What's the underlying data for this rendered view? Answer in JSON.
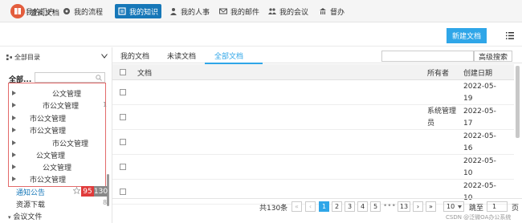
{
  "nav": {
    "items": [
      {
        "label": "我的门户",
        "icon": "portal-icon"
      },
      {
        "label": "我的流程",
        "icon": "workflow-icon"
      },
      {
        "label": "我的知识",
        "icon": "knowledge-icon"
      },
      {
        "label": "我的人事",
        "icon": "person-icon"
      },
      {
        "label": "我的邮件",
        "icon": "mail-icon"
      },
      {
        "label": "我的会议",
        "icon": "meeting-icon"
      },
      {
        "label": "督办",
        "icon": "supervise-icon"
      }
    ],
    "active_index": 2
  },
  "header": {
    "title": "查阅文档",
    "new_button": "新建文档"
  },
  "left": {
    "directory_select": "全部目录",
    "tree_root": "全部...",
    "tree_items": [
      {
        "label": "公文管理",
        "count": ""
      },
      {
        "label": "市公文管理",
        "count": "1"
      },
      {
        "label": "市公文管理",
        "count": ""
      },
      {
        "label": "市公文管理",
        "count": ""
      },
      {
        "label": "市公文管理",
        "count": ""
      },
      {
        "label": "公文管理",
        "count": ""
      },
      {
        "label": "公文管理",
        "count": ""
      },
      {
        "label": "市公文管理",
        "count": ""
      }
    ],
    "notice": {
      "label": "通知公告",
      "unread": "95",
      "total": "130"
    },
    "resource": {
      "label": "资源下载",
      "count": "8"
    },
    "meeting": {
      "label": "会议文件"
    }
  },
  "tabs": [
    {
      "label": "我的文档"
    },
    {
      "label": "未读文档"
    },
    {
      "label": "全部文档"
    }
  ],
  "active_tab": 2,
  "search": {
    "placeholder": "",
    "advanced_button": "高级搜索"
  },
  "table": {
    "columns": {
      "doc": "文档",
      "owner": "所有者",
      "created": "创建日期"
    },
    "rows": [
      {
        "owner": "",
        "created": "2022-05-19"
      },
      {
        "owner": "系统管理员",
        "created": "2022-05-17"
      },
      {
        "owner": "",
        "created": "2022-05-16"
      },
      {
        "owner": "",
        "created": "2022-05-10"
      },
      {
        "owner": "",
        "created": "2022-05-10"
      }
    ]
  },
  "pagination": {
    "total": "共130条",
    "pages": [
      "1",
      "2",
      "3",
      "4",
      "5"
    ],
    "ellipsis": "•••",
    "last_page": "13",
    "page_size": "10",
    "jump_label": "跳至",
    "jump_value": "1",
    "page_suffix": "页"
  },
  "watermark": "CSDN @泛微OA办公系统",
  "colors": {
    "accent": "#2fa6e8",
    "nav_active": "#1677b8",
    "badge_red": "#e03b3b",
    "highlight_border": "#e36a6a"
  }
}
